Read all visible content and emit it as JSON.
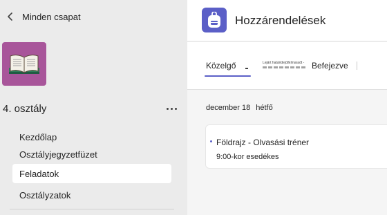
{
  "sidebar": {
    "back_label": "Minden csapat",
    "team_name": "4. osztály",
    "nav": [
      {
        "label": "Kezdőlap"
      },
      {
        "label": "Osztályjegyzetfüzet"
      },
      {
        "label": "Feladatok"
      },
      {
        "label": "Osztályzatok"
      }
    ],
    "active_index": 2
  },
  "header": {
    "title": "Hozzárendelések"
  },
  "tabs": {
    "upcoming": "Közelgő",
    "past_due_overlay": "Lejárt határidejű/Elmaradt -",
    "completed": "Befejezve"
  },
  "list": {
    "date": "december 18",
    "weekday": "hétfő",
    "assignment": {
      "title": "Földrajz - Olvasási tréner",
      "due": "9:00-kor esedékes"
    }
  },
  "colors": {
    "sidebar_bg": "#ebebeb",
    "team_tile": "#a8559a",
    "accent": "#5b5fc7"
  },
  "icons": [
    "chevron-left-icon",
    "book-icon",
    "more-icon",
    "backpack-icon"
  ]
}
